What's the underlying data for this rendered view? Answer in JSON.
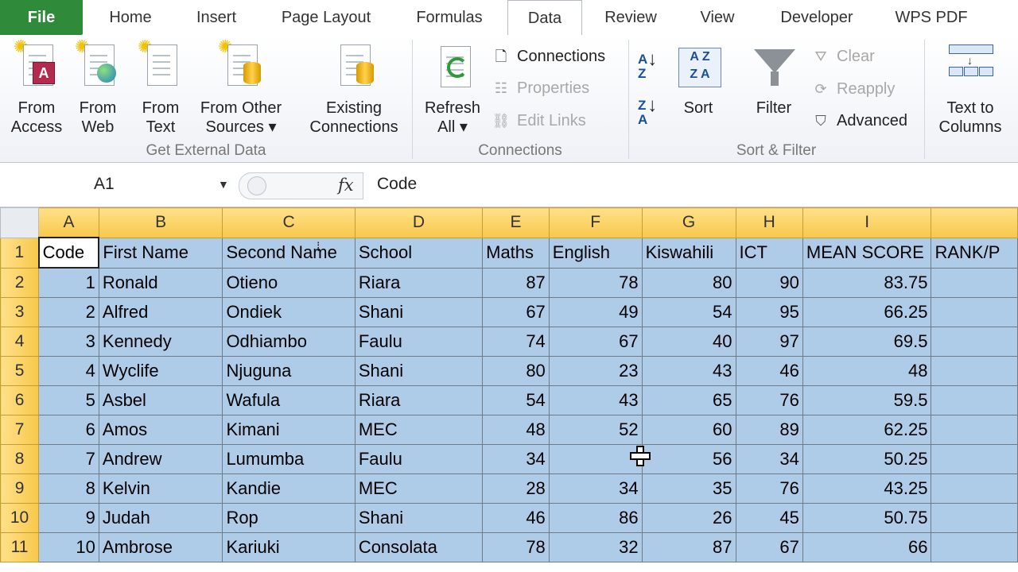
{
  "tabs": [
    "File",
    "Home",
    "Insert",
    "Page Layout",
    "Formulas",
    "Data",
    "Review",
    "View",
    "Developer",
    "WPS PDF"
  ],
  "active_tab": "Data",
  "ribbon": {
    "get_external_data": {
      "label": "Get External Data",
      "from_access": [
        "From",
        "Access"
      ],
      "from_web": [
        "From",
        "Web"
      ],
      "from_text": [
        "From",
        "Text"
      ],
      "from_other": [
        "From Other",
        "Sources ▾"
      ],
      "existing": [
        "Existing",
        "Connections"
      ]
    },
    "connections": {
      "label": "Connections",
      "refresh": [
        "Refresh",
        "All ▾"
      ],
      "connections": "Connections",
      "properties": "Properties",
      "edit_links": "Edit Links"
    },
    "sort_filter": {
      "label": "Sort & Filter",
      "sort": "Sort",
      "filter": "Filter",
      "clear": "Clear",
      "reapply": "Reapply",
      "advanced": "Advanced"
    },
    "data_tools": {
      "text_to_columns": [
        "Text to",
        "Columns"
      ]
    }
  },
  "formula_bar": {
    "name_box": "A1",
    "fx": "fx",
    "content": "Code"
  },
  "columns": [
    "A",
    "B",
    "C",
    "D",
    "E",
    "F",
    "G",
    "H",
    "I",
    ""
  ],
  "header_row": [
    "Code",
    "First Name",
    "Second Name",
    "School",
    "Maths",
    "English",
    "Kiswahili",
    "ICT",
    "MEAN SCORE",
    "RANK/P"
  ],
  "rows": [
    [
      "1",
      "Ronald",
      "Otieno",
      "Riara",
      "87",
      "78",
      "80",
      "90",
      "83.75",
      ""
    ],
    [
      "2",
      "Alfred",
      "Ondiek",
      "Shani",
      "67",
      "49",
      "54",
      "95",
      "66.25",
      ""
    ],
    [
      "3",
      "Kennedy",
      "Odhiambo",
      "Faulu",
      "74",
      "67",
      "40",
      "97",
      "69.5",
      ""
    ],
    [
      "4",
      "Wyclife",
      "Njuguna",
      "Shani",
      "80",
      "23",
      "43",
      "46",
      "48",
      ""
    ],
    [
      "5",
      "Asbel",
      "Wafula",
      "Riara",
      "54",
      "43",
      "65",
      "76",
      "59.5",
      ""
    ],
    [
      "6",
      "Amos",
      "Kimani",
      "MEC",
      "48",
      "52",
      "60",
      "89",
      "62.25",
      ""
    ],
    [
      "7",
      "Andrew",
      "Lumumba",
      "Faulu",
      "34",
      "",
      "56",
      "34",
      "50.25",
      ""
    ],
    [
      "8",
      "Kelvin",
      "Kandie",
      "MEC",
      "28",
      "34",
      "35",
      "76",
      "43.25",
      ""
    ],
    [
      "9",
      "Judah",
      "Rop",
      "Shani",
      "46",
      "86",
      "26",
      "45",
      "50.75",
      ""
    ],
    [
      "10",
      "Ambrose",
      "Kariuki",
      "Consolata",
      "78",
      "32",
      "87",
      "67",
      "66",
      ""
    ]
  ],
  "row_numbers": [
    "1",
    "2",
    "3",
    "4",
    "5",
    "6",
    "7",
    "8",
    "9",
    "10",
    "11"
  ]
}
